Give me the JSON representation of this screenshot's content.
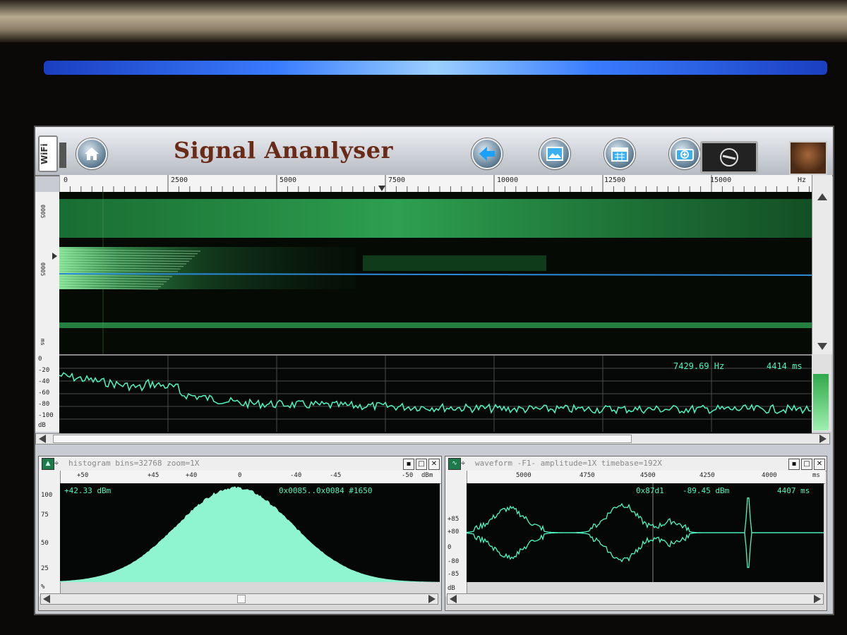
{
  "titlebar": {
    "wifi_label": "WiFi",
    "title": "Signal Ananlyser",
    "icons": [
      "home-icon",
      "back-arrow-icon",
      "image-icon",
      "calendar-icon",
      "camera-icon",
      "toggle-icon",
      "avatar-icon"
    ]
  },
  "frequency_ruler": {
    "unit": "Hz",
    "ticks": [
      "0",
      "2500",
      "5000",
      "7500",
      "10000",
      "12500",
      "15000"
    ]
  },
  "spectrum": {
    "db_ticks": [
      "0",
      "-20",
      "-40",
      "-60",
      "-80",
      "-100",
      "dB"
    ],
    "freq_readout": "7429.69 Hz",
    "time_readout": "4414 ms"
  },
  "spectrogram": {
    "time_unit": "ms"
  },
  "histogram": {
    "title": "histogram  bins=32768 zoom=1X",
    "x_unit": "dBm",
    "x_ticks": [
      "+50",
      "+45",
      "+40",
      "0",
      "-40",
      "-45",
      "-50"
    ],
    "y_ticks": [
      "100",
      "75",
      "50",
      "25",
      "%"
    ],
    "readout_level": "+42.33 dBm",
    "readout_range": "0x0085..0x0084 #1650"
  },
  "waveform": {
    "title": "waveform  -F1- amplitude=1X timebase=192X",
    "x_unit": "ms",
    "x_ticks": [
      "5000",
      "4750",
      "4500",
      "4250",
      "4000"
    ],
    "y_ticks": [
      "+85",
      "+80",
      "0",
      "-80",
      "-85",
      "dB"
    ],
    "readout_addr": "0x87d1",
    "readout_level": "-89.45 dBm",
    "readout_time": "4407 ms"
  },
  "window_buttons": {
    "minimize": "▪",
    "maximize": "□",
    "close": "✕"
  },
  "colors": {
    "trace": "#4ef5c0",
    "spectrogram": "#2fd060",
    "histogram_fill": "#8ff5d0",
    "title_text": "#6a2a18",
    "glow": "#3a7cff"
  }
}
